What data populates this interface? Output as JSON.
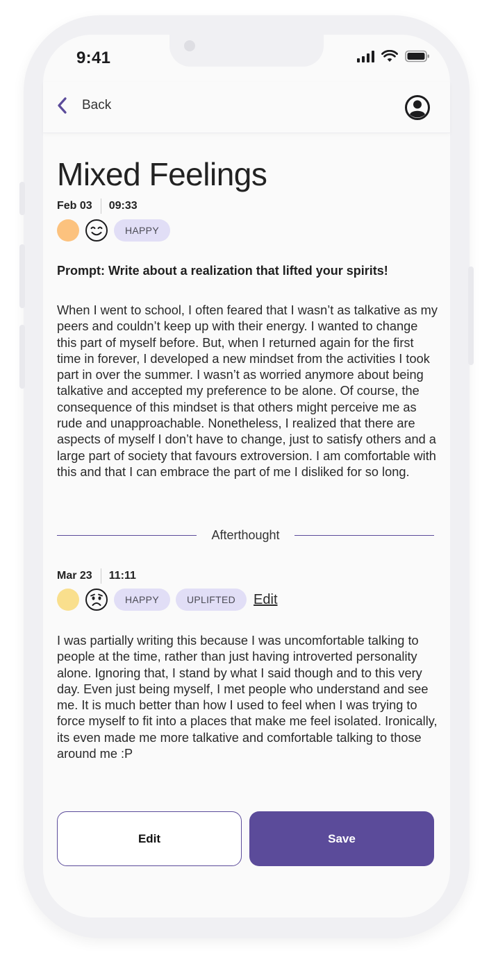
{
  "status_bar": {
    "time": "9:41"
  },
  "header": {
    "back_label": "Back"
  },
  "entry": {
    "title": "Mixed Feelings",
    "date": "Feb 03",
    "time": "09:33",
    "mood_color": "#fcc27e",
    "emoji_icon": "smiling-face-icon",
    "tags": [
      "HAPPY"
    ],
    "prompt": "Prompt: Write about a realization that lifted your spirits!",
    "body": "When I went to school, I often feared that I wasn’t as talkative as my peers and couldn’t keep up with their energy. I wanted to change this part of myself before. But, when I returned again for the first time in forever, I developed a new mindset from the activities I took part in over the summer. I wasn’t as worried anymore about being talkative and accepted my preference to be alone. Of course, the consequence of this mindset is that others might perceive me as rude and unapproachable. Nonetheless, I realized that there are aspects of myself I don’t have to change, just to satisfy others and a large part of society that favours extroversion. I am comfortable with this and that I can embrace the part of me I disliked for so long."
  },
  "afterthought": {
    "divider_label": "Afterthought",
    "date": "Mar 23",
    "time": "11:11",
    "mood_color": "#f9df8d",
    "emoji_icon": "worried-face-icon",
    "tags": [
      "HAPPY",
      "UPLIFTED"
    ],
    "edit_link": "Edit",
    "body": "I was partially writing this because I was uncomfortable talking to people at the time, rather than just having introverted personality alone. Ignoring that, I stand by what I said though and to this very day. Even just being myself, I met people who understand and see me. It is much better than how I used to feel when I was trying to force myself to fit into a places that make me feel isolated. Ironically, its even made me more talkative and comfortable talking to those around me :P"
  },
  "actions": {
    "edit_label": "Edit",
    "save_label": "Save"
  },
  "colors": {
    "accent": "#5b4b9a",
    "chip_bg": "#e1def6"
  }
}
